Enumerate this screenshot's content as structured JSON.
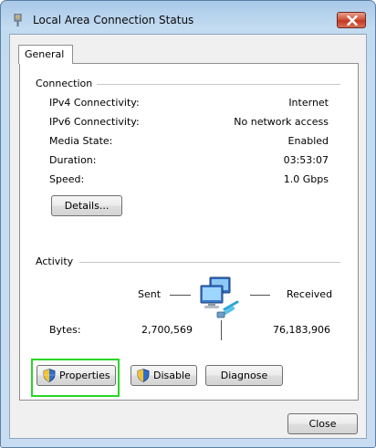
{
  "window": {
    "title": "Local Area Connection Status",
    "icon": "network-adapter-icon"
  },
  "tabs": [
    {
      "label": "General",
      "selected": true
    }
  ],
  "connection": {
    "group_label": "Connection",
    "rows": [
      {
        "label": "IPv4 Connectivity:",
        "value": "Internet"
      },
      {
        "label": "IPv6 Connectivity:",
        "value": "No network access"
      },
      {
        "label": "Media State:",
        "value": "Enabled"
      },
      {
        "label": "Duration:",
        "value": "03:53:07"
      },
      {
        "label": "Speed:",
        "value": "1.0 Gbps"
      }
    ],
    "details_button": "Details..."
  },
  "activity": {
    "group_label": "Activity",
    "sent_label": "Sent",
    "received_label": "Received",
    "bytes_label": "Bytes:",
    "bytes_sent": "2,700,569",
    "bytes_received": "76,183,906",
    "icon": "network-computers-icon"
  },
  "buttons": {
    "properties": "Properties",
    "disable": "Disable",
    "diagnose": "Diagnose",
    "close": "Close"
  },
  "colors": {
    "highlight": "#27d627",
    "close_button": "#c33a23"
  }
}
